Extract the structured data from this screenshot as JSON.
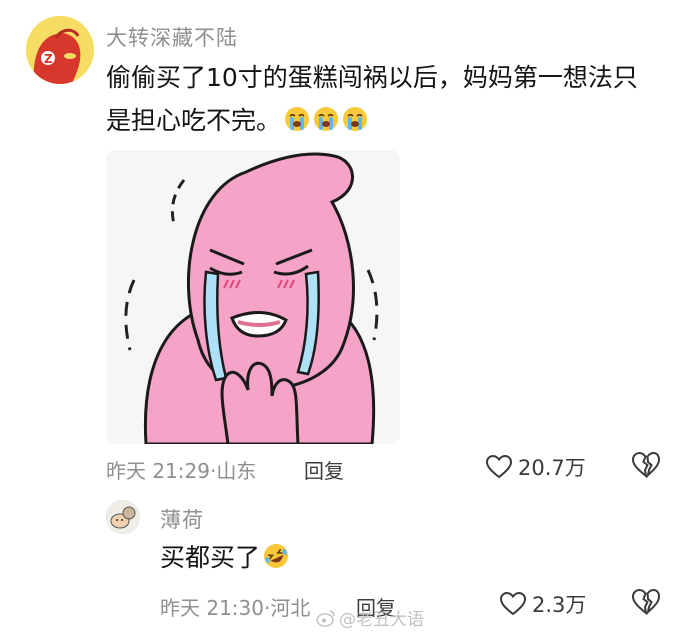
{
  "comments": [
    {
      "username": "大转深藏不陆",
      "text_line1": "偷偷买了10寸的蛋糕闯祸以后，妈妈第一想法只",
      "text_line2": "是担心吃不完。",
      "emoji": "loudly-crying-face",
      "sticker": "pink-crying-character",
      "time": "昨天 21:29",
      "location": "山东",
      "reply_label": "回复",
      "likes": "20.7万"
    },
    {
      "username": "薄荷",
      "text": "买都买了",
      "emoji": "rolling-on-floor-laughing",
      "time": "昨天 21:30",
      "location": "河北",
      "reply_label": "回复",
      "likes": "2.3万"
    }
  ],
  "watermark": "@老丑大语",
  "colors": {
    "sticker_pink": "#f5a3c7",
    "avatar_yellow": "#f7dc63",
    "meta_gray": "#8f8f8f"
  },
  "icons": [
    "heart-outline-icon",
    "broken-heart-outline-icon",
    "weibo-icon"
  ]
}
